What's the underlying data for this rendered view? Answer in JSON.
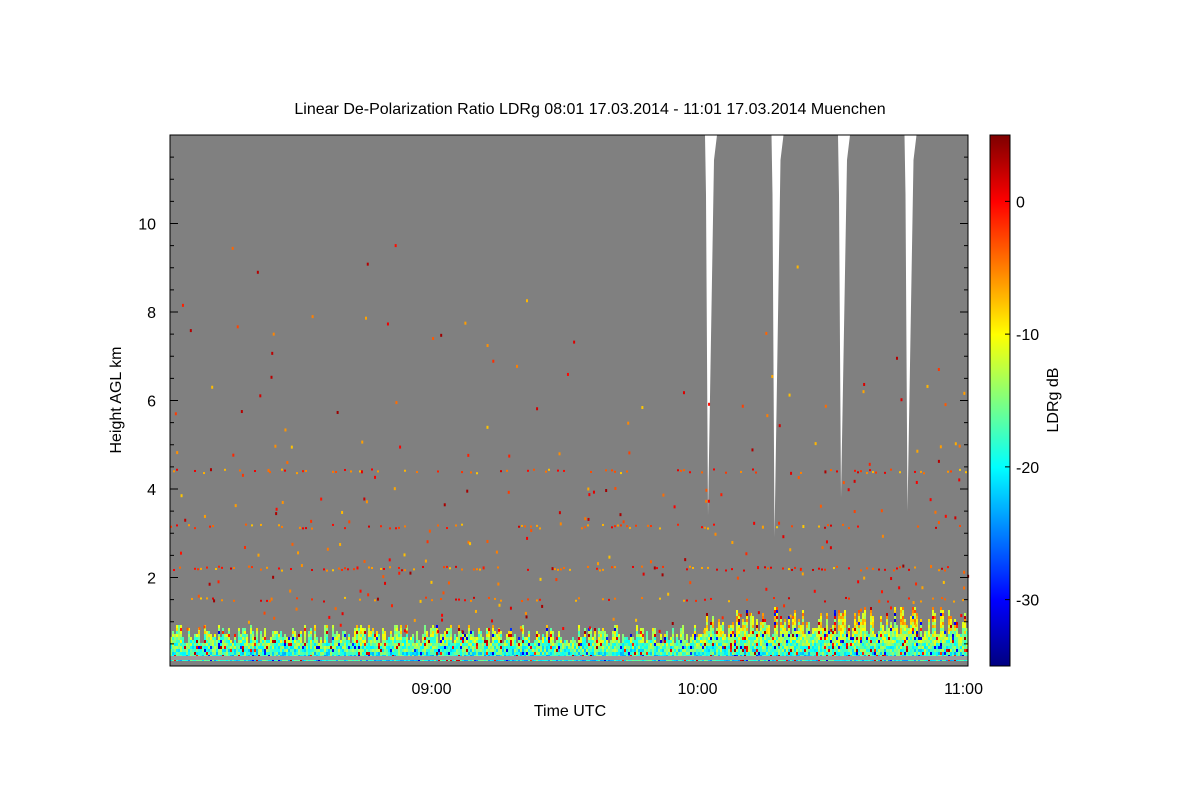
{
  "chart_data": {
    "type": "heatmap",
    "title": "Linear De-Polarization Ratio LDRg   08:01 17.03.2014 - 11:01 17.03.2014 Muenchen",
    "xlabel": "Time UTC",
    "ylabel": "Height AGL km",
    "xlim": [
      "08:01",
      "11:01"
    ],
    "ylim": [
      0,
      12
    ],
    "x_ticks": [
      "09:00",
      "10:00",
      "11:00"
    ],
    "y_ticks": [
      2,
      4,
      6,
      8,
      10
    ],
    "colorbar": {
      "label": "LDRg dB",
      "range": [
        -35,
        5
      ],
      "ticks": [
        0,
        -10,
        -20,
        -30
      ],
      "colors": [
        "#00007f",
        "#0000ff",
        "#007fff",
        "#00ffff",
        "#7fff7f",
        "#ffff00",
        "#ff7f00",
        "#ff0000",
        "#7f0000"
      ]
    },
    "background_color": "#808080",
    "features": {
      "surface_layer_top_km": 1.2,
      "aerosol_layers_km": [
        1.5,
        2.2,
        3.15,
        4.4
      ],
      "gap_times": [
        "10:01",
        "10:16",
        "10:31",
        "10:46"
      ],
      "gap_bottom_km": [
        3.4,
        2.9,
        3.8,
        3.5
      ]
    }
  }
}
